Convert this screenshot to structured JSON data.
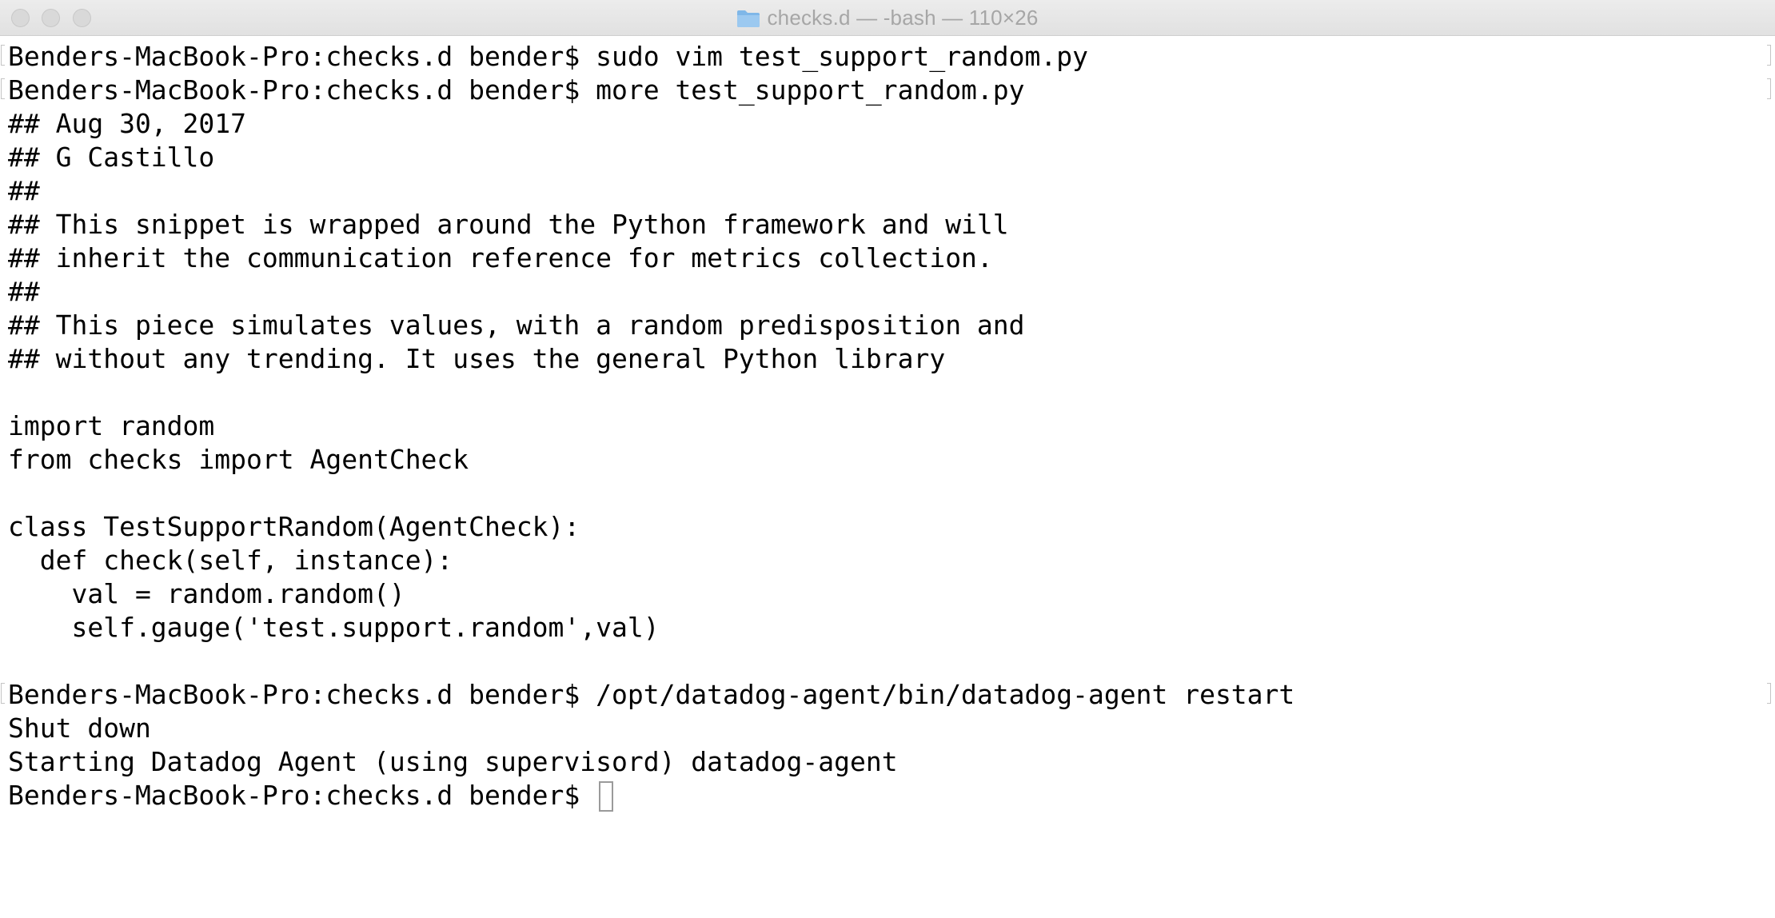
{
  "window": {
    "title": "checks.d — -bash — 110×26",
    "folder_icon": "folder-icon",
    "colors": {
      "background": "#ffffff",
      "text": "#000000",
      "title_text": "#a6a6a6",
      "folder": "#7fb7e8"
    }
  },
  "terminal": {
    "lines": [
      "Benders-MacBook-Pro:checks.d bender$ sudo vim test_support_random.py",
      "Benders-MacBook-Pro:checks.d bender$ more test_support_random.py",
      "## Aug 30, 2017",
      "## G Castillo",
      "##",
      "## This snippet is wrapped around the Python framework and will",
      "## inherit the communication reference for metrics collection.",
      "##",
      "## This piece simulates values, with a random predisposition and",
      "## without any trending. It uses the general Python library",
      "",
      "import random",
      "from checks import AgentCheck",
      "",
      "class TestSupportRandom(AgentCheck):",
      "  def check(self, instance):",
      "    val = random.random()",
      "    self.gauge('test.support.random',val)",
      "",
      "Benders-MacBook-Pro:checks.d bender$ /opt/datadog-agent/bin/datadog-agent restart",
      "Shut down",
      "Starting Datadog Agent (using supervisord) datadog-agent",
      "Benders-MacBook-Pro:checks.d bender$ "
    ]
  }
}
